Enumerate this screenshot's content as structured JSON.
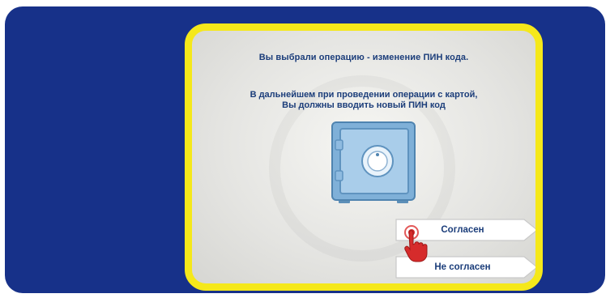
{
  "dialog": {
    "title": "Вы выбрали операцию - изменение ПИН кода.",
    "message_line1": "В дальнейшем при проведении операции с картой,",
    "message_line2": "Вы должны вводить новый ПИН код"
  },
  "buttons": {
    "agree_label": "Согласен",
    "disagree_label": "Не согласен"
  },
  "icons": {
    "illustration": "safe-icon",
    "cursor": "pointing-hand-icon"
  },
  "colors": {
    "screen_background": "#173189",
    "dialog_border": "#f5e81a",
    "text": "#1b3d7a",
    "accent": "#d62b2b"
  }
}
